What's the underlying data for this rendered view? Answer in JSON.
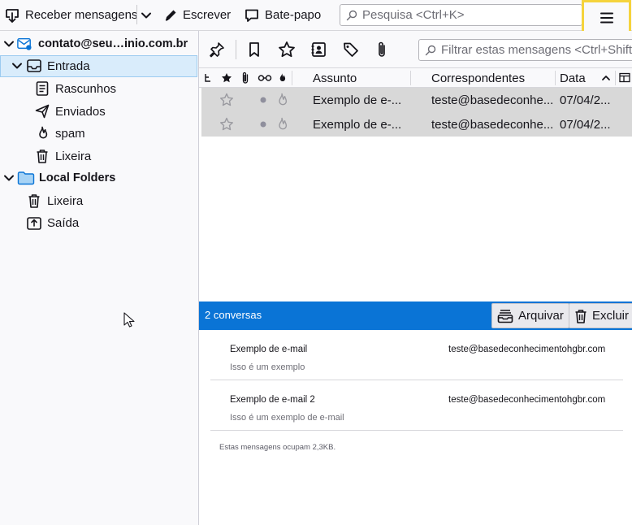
{
  "toolbar": {
    "get_messages_label": "Receber mensagens",
    "write_label": "Escrever",
    "chat_label": "Bate-papo",
    "search_placeholder": "Pesquisa <Ctrl+K>"
  },
  "folders": {
    "account": "contato@seu…inio.com.br",
    "inbox": "Entrada",
    "drafts": "Rascunhos",
    "sent": "Enviados",
    "spam": "spam",
    "trash": "Lixeira",
    "local_folders": "Local Folders",
    "local_trash": "Lixeira",
    "outbox": "Saída"
  },
  "quick_filter": {
    "filter_placeholder": "Filtrar estas mensagens <Ctrl+Shift+K>"
  },
  "thread_columns": {
    "subject": "Assunto",
    "correspondents": "Correspondentes",
    "date": "Data"
  },
  "messages": [
    {
      "subject": "Exemplo de e-...",
      "correspondent": "teste@basedeconhe...",
      "date": "07/04/2..."
    },
    {
      "subject": "Exemplo de e-...",
      "correspondent": "teste@basedeconhe...",
      "date": "07/04/2..."
    }
  ],
  "summary": {
    "count": "2 conversas",
    "archive_label": "Arquivar",
    "delete_label": "Excluir",
    "items": [
      {
        "subject": "Exemplo de e-mail",
        "from": "teste@basedeconhecimentohgbr.com",
        "snippet": "Isso é um exemplo"
      },
      {
        "subject": "Exemplo de e-mail 2",
        "from": "teste@basedeconhecimentohgbr.com",
        "snippet": "Isso é um exemplo de e-mail"
      }
    ],
    "size_note": "Estas mensagens ocupam 2,3KB."
  },
  "colors": {
    "accent": "#0a74d6",
    "selected_folder": "#d9ecfb",
    "menu_highlight": "#f5d33c",
    "selected_row": "#d8d8d8"
  }
}
